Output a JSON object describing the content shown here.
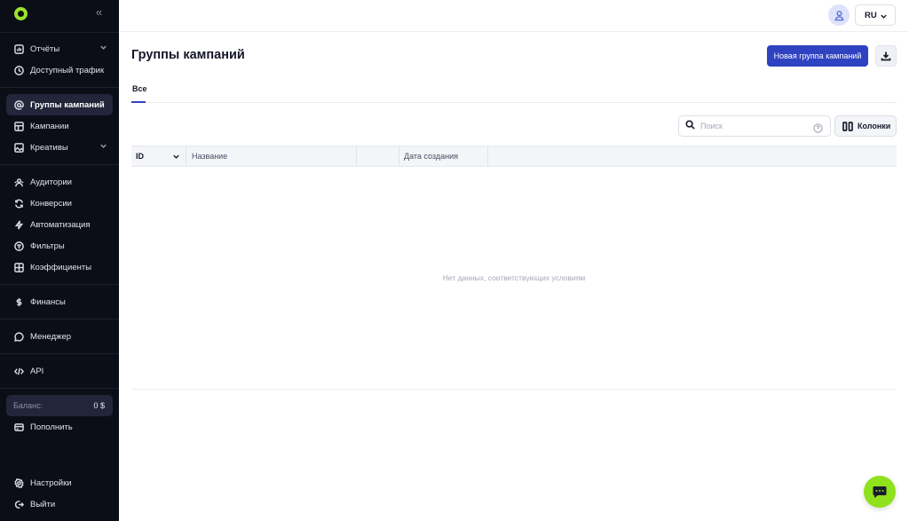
{
  "sidebar": {
    "items": [
      {
        "label": "Отчёты"
      },
      {
        "label": "Доступный трафик"
      },
      {
        "label": "Группы кампаний"
      },
      {
        "label": "Кампании"
      },
      {
        "label": "Креативы"
      },
      {
        "label": "Аудитории"
      },
      {
        "label": "Конверсии"
      },
      {
        "label": "Автоматизация"
      },
      {
        "label": "Фильтры"
      },
      {
        "label": "Коэффициенты"
      },
      {
        "label": "Финансы"
      },
      {
        "label": "Менеджер"
      },
      {
        "label": "API"
      },
      {
        "label": "Пополнить"
      },
      {
        "label": "Настройки"
      },
      {
        "label": "Выйти"
      }
    ],
    "balance": {
      "label": "Баланс:",
      "value": "0 $"
    }
  },
  "topbar": {
    "language": "RU"
  },
  "page": {
    "title": "Группы кампаний",
    "new_button": "Новая группа кампаний"
  },
  "tabs": [
    {
      "label": "Все",
      "active": true
    }
  ],
  "search": {
    "placeholder": "Поиск"
  },
  "columns_button": "Колонки",
  "table": {
    "headers": [
      "ID",
      "Название",
      "",
      "Дата создания"
    ],
    "empty_text": "Нет данных, соответствующих условиям"
  },
  "colors": {
    "sidebar_bg": "#0b0d17",
    "accent": "#2f42c1",
    "brand_green": "#8fe11c"
  }
}
